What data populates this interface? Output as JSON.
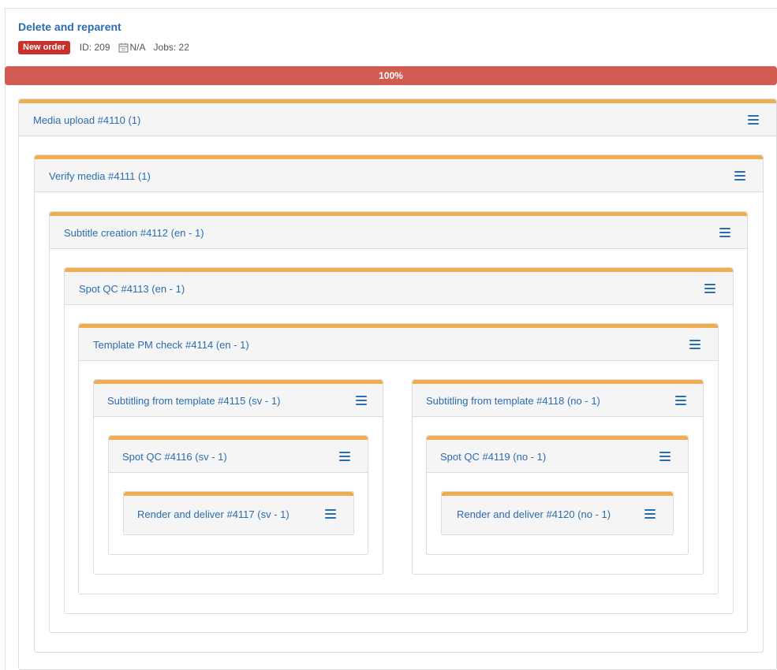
{
  "order": {
    "title": "Delete and reparent",
    "status_badge": "New order",
    "id_text": "ID: 209",
    "date_text": "N/A",
    "jobs_text": "Jobs: 22"
  },
  "progress": {
    "label": "100%",
    "fraction": 1.0
  },
  "colors": {
    "accent_header": "#f0ad4e",
    "progress_fill": "#d05c52",
    "badge": "#c9302c",
    "link": "#2a6db0"
  },
  "tasks": {
    "t4110": {
      "label": "Media upload #4110 (1)",
      "menu_icon": "menu-icon"
    },
    "t4111": {
      "label": "Verify media #4111 (1)",
      "menu_icon": "menu-icon"
    },
    "t4112": {
      "label": "Subtitle creation #4112 (en - 1)",
      "menu_icon": "menu-icon"
    },
    "t4113": {
      "label": "Spot QC #4113 (en - 1)",
      "menu_icon": "menu-icon"
    },
    "t4114": {
      "label": "Template PM check #4114 (en - 1)",
      "menu_icon": "menu-icon"
    },
    "t4115": {
      "label": "Subtitling from template #4115 (sv - 1)",
      "menu_icon": "menu-icon"
    },
    "t4116": {
      "label": "Spot QC #4116 (sv - 1)",
      "menu_icon": "menu-icon"
    },
    "t4117": {
      "label": "Render and deliver #4117 (sv - 1)",
      "menu_icon": "menu-icon"
    },
    "t4118": {
      "label": "Subtitling from template #4118 (no - 1)",
      "menu_icon": "menu-icon"
    },
    "t4119": {
      "label": "Spot QC #4119 (no - 1)",
      "menu_icon": "menu-icon"
    },
    "t4120": {
      "label": "Render and deliver #4120 (no - 1)",
      "menu_icon": "menu-icon"
    }
  }
}
